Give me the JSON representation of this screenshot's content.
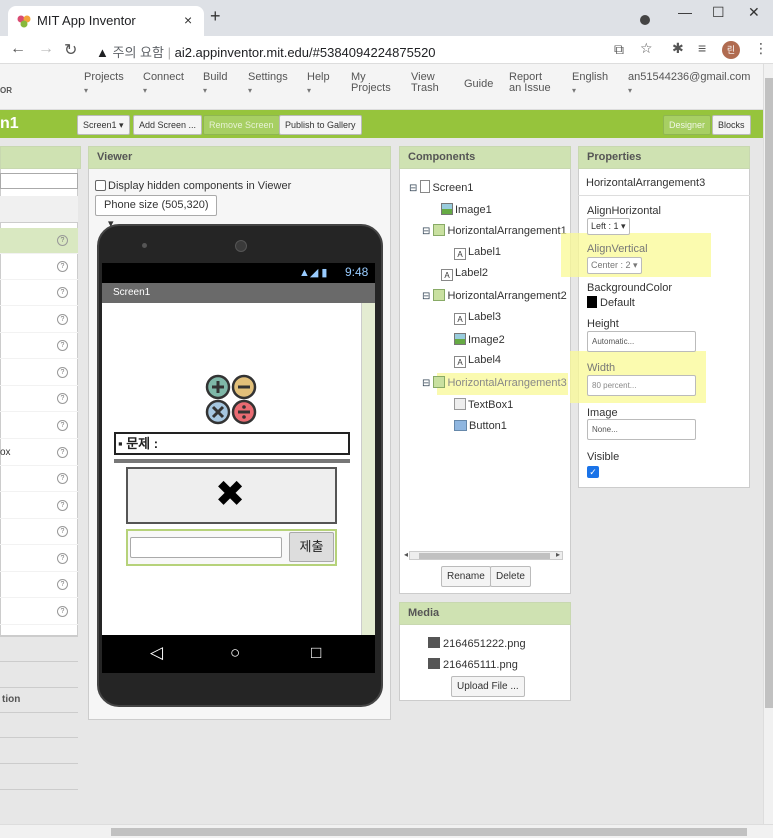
{
  "browser": {
    "tab_title": "MIT App Inventor",
    "tab_close": "×",
    "new_tab": "+",
    "address_prefix": "주의 요함",
    "address_sep": "|",
    "address_url": "ai2.appinventor.mit.edu/#5384094224875520",
    "window_min": "—",
    "window_max": "☐",
    "window_close": "✕",
    "avatar_text": "린"
  },
  "app_header": {
    "logo_tail": "OR",
    "menus": [
      {
        "label": "Projects",
        "dd": "▾"
      },
      {
        "label": "Connect",
        "dd": "▾"
      },
      {
        "label": "Build",
        "dd": "▾"
      },
      {
        "label": "Settings",
        "dd": "▾"
      },
      {
        "label": "Help",
        "dd": "▾"
      },
      {
        "label": "My Projects",
        "dd": ""
      },
      {
        "label": "View Trash",
        "dd": ""
      },
      {
        "label": "Guide",
        "dd": ""
      },
      {
        "label": "Report an Issue",
        "dd": ""
      },
      {
        "label": "English",
        "dd": "▾"
      },
      {
        "label": "an51544236@gmail.com",
        "dd": "▾"
      }
    ]
  },
  "toolbar": {
    "screen_name": "n1",
    "screen_select": "Screen1 ▾",
    "add_screen": "Add Screen ...",
    "remove_screen": "Remove Screen",
    "publish": "Publish to Gallery",
    "designer": "Designer",
    "blocks": "Blocks"
  },
  "palette": {
    "partial_item": "ox",
    "partial_category": "tion",
    "help_glyph": "?"
  },
  "viewer": {
    "title": "Viewer",
    "hidden_checkbox_label": "Display hidden components in Viewer",
    "phone_size": "Phone size (505,320)",
    "phone_size_dd": "▾",
    "status_time": "9:48",
    "screen_title": "Screen1",
    "label1_text": "▪ 문제 :",
    "xmark": "✖",
    "button1_text": "제출",
    "nav_back": "◁",
    "nav_home": "○",
    "nav_recent": "□"
  },
  "components": {
    "title": "Components",
    "tree": [
      {
        "name": "Screen1",
        "icon": "screen-icon",
        "toggle": "⊟"
      },
      {
        "name": "Image1",
        "icon": "image-icon",
        "toggle": ""
      },
      {
        "name": "HorizontalArrangement1",
        "icon": "arrangement-icon",
        "toggle": "⊟"
      },
      {
        "name": "Label1",
        "icon": "label-icon",
        "toggle": ""
      },
      {
        "name": "Label2",
        "icon": "label-icon",
        "toggle": ""
      },
      {
        "name": "HorizontalArrangement2",
        "icon": "arrangement-icon",
        "toggle": "⊟"
      },
      {
        "name": "Label3",
        "icon": "label-icon",
        "toggle": ""
      },
      {
        "name": "Image2",
        "icon": "image-icon",
        "toggle": ""
      },
      {
        "name": "Label4",
        "icon": "label-icon",
        "toggle": ""
      },
      {
        "name": "HorizontalArrangement3",
        "icon": "arrangement-icon",
        "toggle": "⊟"
      },
      {
        "name": "TextBox1",
        "icon": "textbox-icon",
        "toggle": ""
      },
      {
        "name": "Button1",
        "icon": "button-icon",
        "toggle": ""
      }
    ],
    "rename": "Rename",
    "delete": "Delete",
    "scroll_left": "◂",
    "scroll_right": "▸"
  },
  "media": {
    "title": "Media",
    "files": [
      "2164651222.png",
      "216465111.png"
    ],
    "upload": "Upload File ..."
  },
  "properties": {
    "title": "Properties",
    "component": "HorizontalArrangement3",
    "align_h_label": "AlignHorizontal",
    "align_h_value": "Left : 1 ▾",
    "align_v_label": "AlignVertical",
    "align_v_value": "Center : 2 ▾",
    "bg_label": "BackgroundColor",
    "bg_value": "Default",
    "height_label": "Height",
    "height_value": "Automatic...",
    "width_label": "Width",
    "width_value": "80 percent...",
    "image_label": "Image",
    "image_value": "None...",
    "visible_label": "Visible",
    "visible_check": "✓"
  },
  "colors": {
    "toolbar_green": "#96c43c",
    "panel_header": "#cfe2b2",
    "highlight": "#fafa94"
  }
}
